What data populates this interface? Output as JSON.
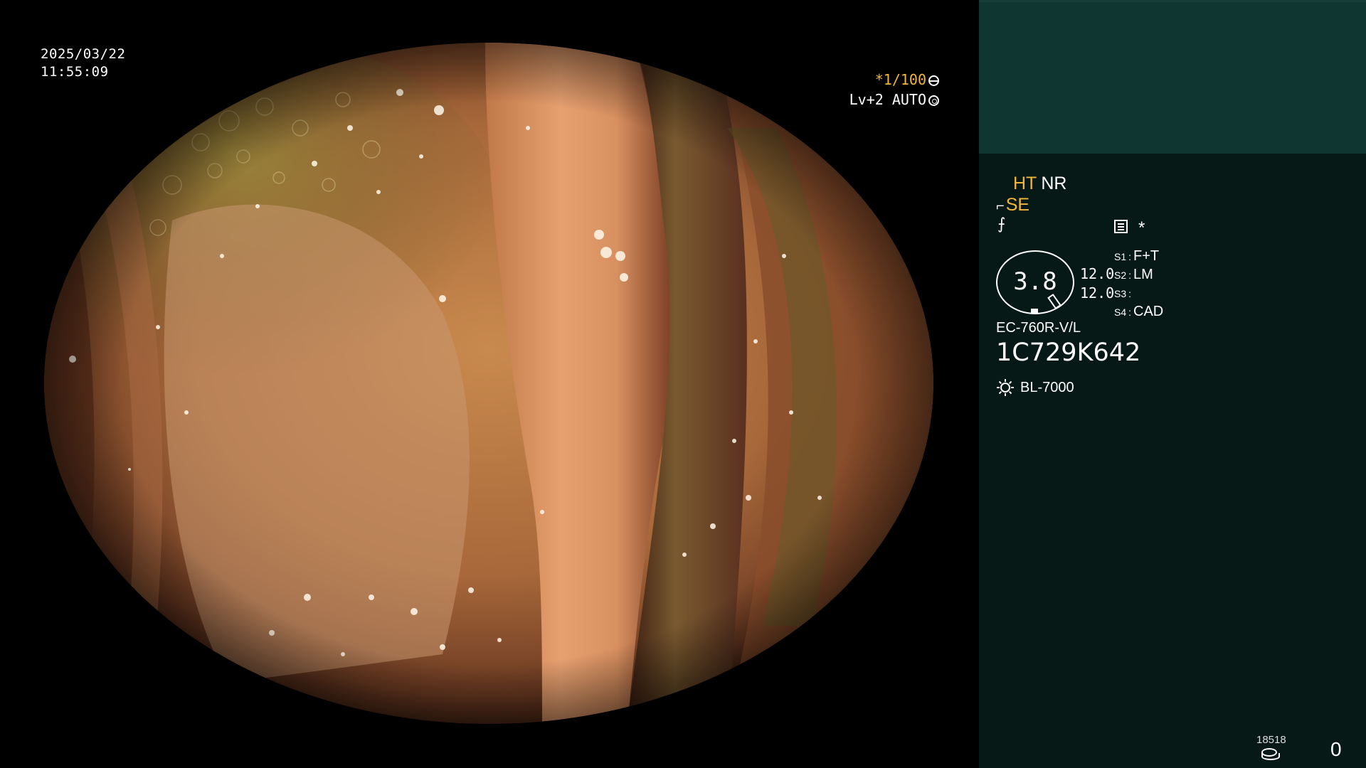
{
  "scope_view": {
    "date": "2025/03/22",
    "time": "11:55:09",
    "shutter": "*1/100",
    "enhance": "Lv+2 AUTO"
  },
  "panel": {
    "mode_ht": "HT",
    "mode_nr": "NR",
    "mode_se": "SE",
    "mode_se_symbol": "⌐",
    "mode_f_symbol": "⨍",
    "star": "*",
    "gauge_value": "3.8",
    "gauge_nums": [
      "12.0",
      "12.0"
    ],
    "settings": [
      {
        "key": "S1",
        "value": "F+T"
      },
      {
        "key": "S2",
        "value": "LM"
      },
      {
        "key": "S3",
        "value": ""
      },
      {
        "key": "S4",
        "value": "CAD"
      }
    ],
    "scope_model": "EC-760R-V/L",
    "scope_serial": "1C729K642",
    "light_source": "BL-7000",
    "counter_small": "18518",
    "counter_big": "0"
  },
  "colors": {
    "accent": "#f2b63a",
    "panel_bg": "#061916",
    "panel_header": "#0f3631"
  }
}
